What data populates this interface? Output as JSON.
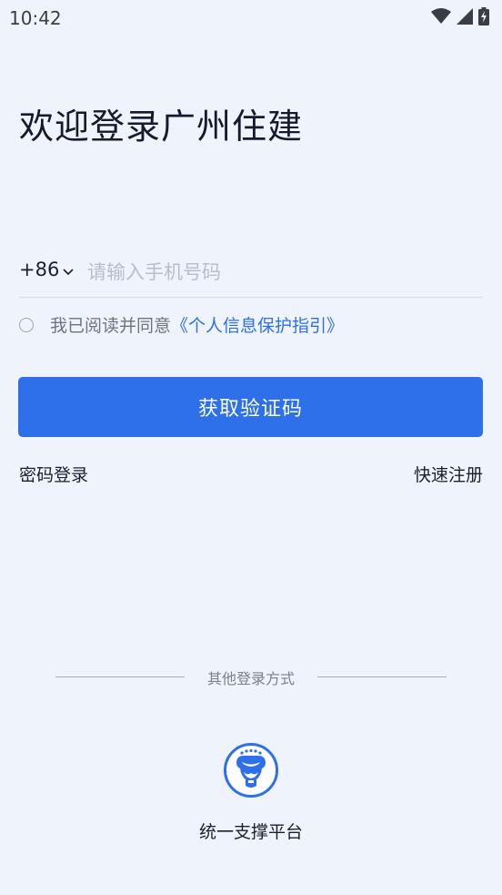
{
  "status_bar": {
    "time": "10:42",
    "icons": [
      "wifi-icon",
      "cellular-signal-icon",
      "battery-charging-icon"
    ]
  },
  "login": {
    "title": "欢迎登录广州住建",
    "country_code": "+86",
    "phone_placeholder": "请输入手机号码",
    "phone_value": "",
    "consent_text": "我已阅读并同意",
    "consent_link": "《个人信息保护指引》",
    "consent_checked": false,
    "submit_label": "获取验证码",
    "password_login": "密码登录",
    "quick_register": "快速注册"
  },
  "other_login": {
    "divider_label": "其他登录方式",
    "platform_label": "统一支撑平台",
    "platform_icon": "unified-platform-logo-icon"
  },
  "colors": {
    "background": "#EFF3FB",
    "primary": "#2E6FEA",
    "link": "#2E6FE8",
    "title": "#141B2E",
    "muted_text": "#6E7480",
    "placeholder": "#B8BDC8"
  }
}
